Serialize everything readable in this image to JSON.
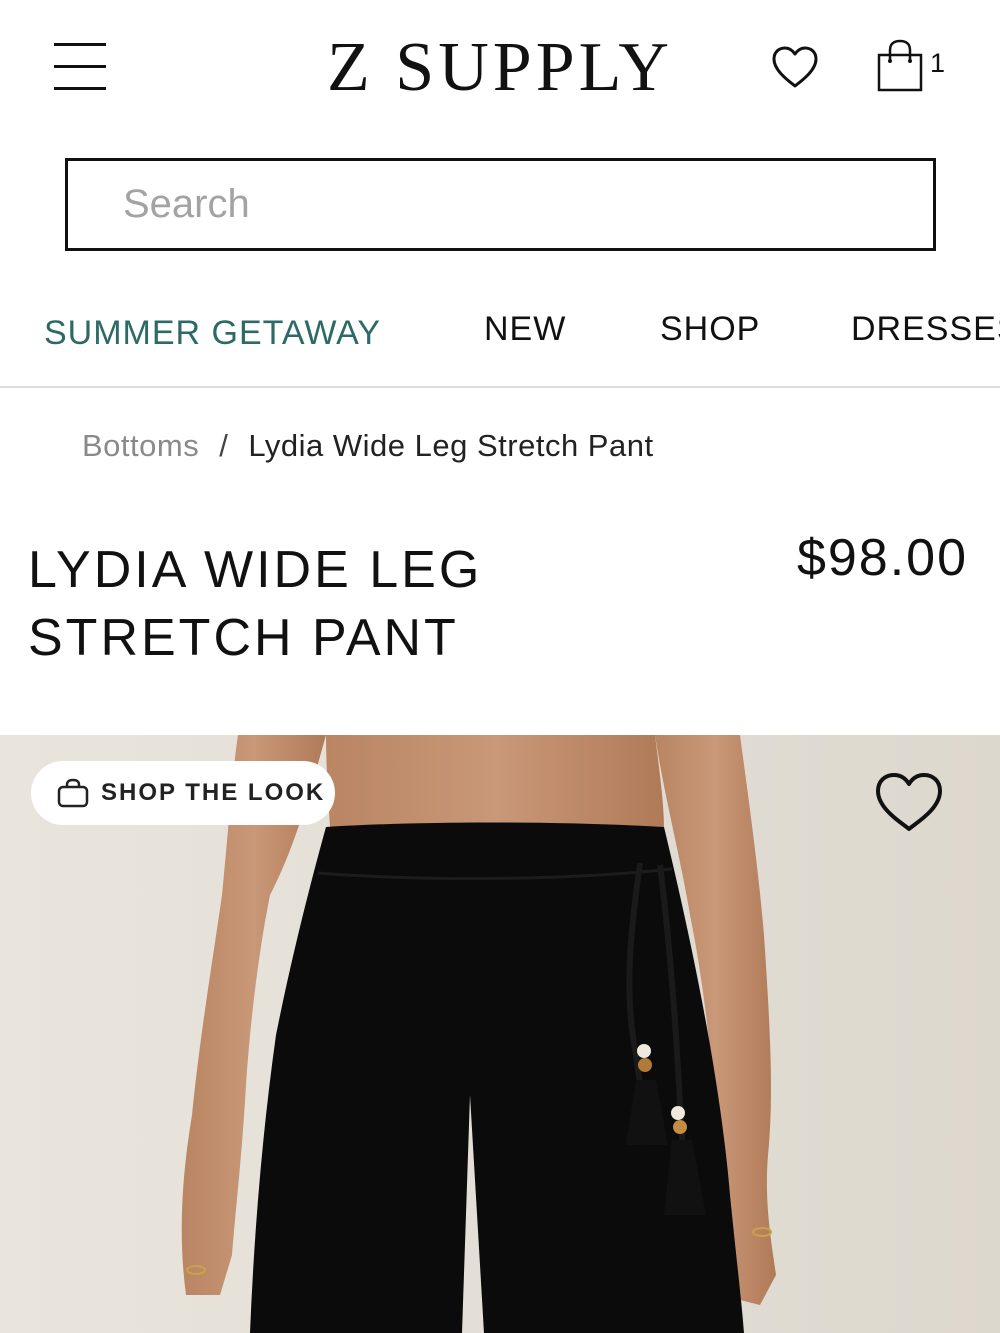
{
  "header": {
    "brand": "Z SUPPLY",
    "menu_icon": "hamburger-menu-icon",
    "wishlist_icon": "heart-icon",
    "cart_icon": "shopping-bag-icon",
    "cart_count": "1"
  },
  "search": {
    "placeholder": "Search",
    "value": ""
  },
  "nav": {
    "items": [
      {
        "label": "SUMMER GETAWAY",
        "active": true
      },
      {
        "label": "NEW",
        "active": false
      },
      {
        "label": "SHOP",
        "active": false
      },
      {
        "label": "DRESSES",
        "active": false
      }
    ]
  },
  "breadcrumb": {
    "parent": "Bottoms",
    "separator": "/",
    "current": "Lydia Wide Leg Stretch Pant"
  },
  "product": {
    "title_line1": "LYDIA WIDE LEG",
    "title_line2": "STRETCH PANT",
    "price": "$98.00"
  },
  "image_overlay": {
    "shop_the_look_label": "SHOP THE LOOK",
    "shop_the_look_icon": "shopping-bag-icon",
    "wishlist_icon": "heart-icon"
  },
  "colors": {
    "accent": "#2d6a66",
    "text": "#111111",
    "muted": "#8a8a8a",
    "image_bg": "#e6e1d8"
  }
}
